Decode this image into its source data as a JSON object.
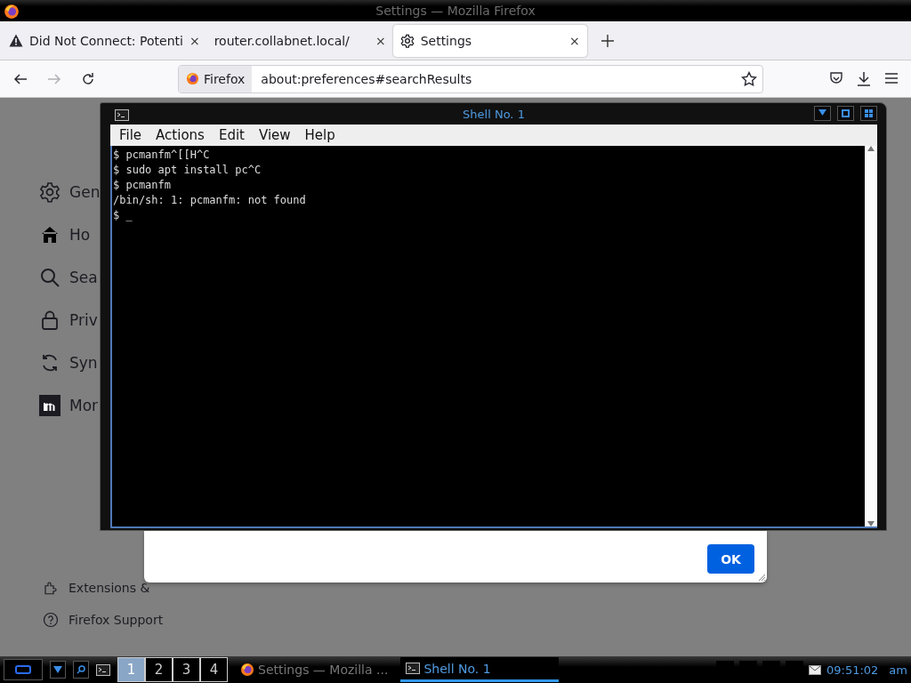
{
  "window": {
    "title": "Settings — Mozilla Firefox"
  },
  "tabs": [
    {
      "label": "Did Not Connect: Potenti",
      "kind": "warning",
      "selected": false,
      "close": "×"
    },
    {
      "label": "router.collabnet.local/",
      "kind": "none",
      "selected": false,
      "close": "×"
    },
    {
      "label": "Settings",
      "kind": "gear",
      "selected": true,
      "close": "×"
    }
  ],
  "navigation": [
    {
      "kind": "back",
      "disabled": false
    },
    {
      "kind": "forward",
      "disabled": true
    },
    {
      "kind": "reload",
      "disabled": false
    }
  ],
  "url_bar": {
    "identity": "Firefox",
    "value": "about:preferences#searchResults"
  },
  "sidebar": {
    "items": [
      {
        "label": "Gen",
        "kind": "gear"
      },
      {
        "label": "Ho",
        "kind": "home"
      },
      {
        "label": "Sea",
        "kind": "search"
      },
      {
        "label": "Priv",
        "kind": "lock"
      },
      {
        "label": "Syn",
        "kind": "sync"
      },
      {
        "label": "Mor",
        "kind": "m"
      }
    ],
    "footer": [
      {
        "label": "Extensions &",
        "kind": "puzzle"
      },
      {
        "label": "Firefox Support",
        "kind": "help"
      }
    ]
  },
  "dialog": {
    "button": "OK"
  },
  "terminal": {
    "title": "Shell No. 1",
    "menu": [
      "File",
      "Actions",
      "Edit",
      "View",
      "Help"
    ],
    "lines": [
      "$ pcmanfm^[[H^C",
      "$ sudo apt install pc^C",
      "$ pcmanfm",
      "/bin/sh: 1: pcmanfm: not found",
      "$ _"
    ]
  },
  "taskbar": {
    "workspaces": [
      {
        "label": "1",
        "selected": true
      },
      {
        "label": "2",
        "selected": false
      },
      {
        "label": "3",
        "selected": false
      },
      {
        "label": "4",
        "selected": false
      }
    ],
    "tasks": [
      {
        "label": "Settings — Mozilla ...",
        "kind": "firefox",
        "selected": false
      },
      {
        "label": "Shell No. 1",
        "kind": "terminal",
        "selected": true
      }
    ],
    "clock": "09:51:02",
    "meridiem": "am"
  }
}
